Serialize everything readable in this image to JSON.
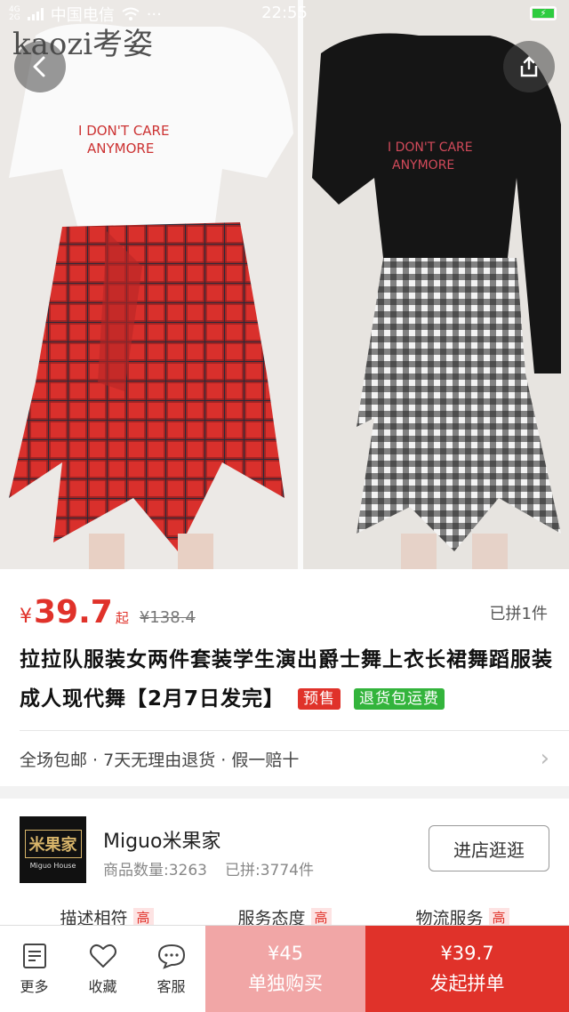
{
  "status_bar": {
    "net_top": "4G",
    "net_bottom": "2G",
    "carrier": "中国电信",
    "dots": "···",
    "time": "22:55",
    "battery_level": 1.0
  },
  "hero": {
    "watermark": "kaozi考姿"
  },
  "product": {
    "price_symbol": "¥",
    "price": "39.7",
    "price_suffix": "起",
    "original_price": "¥138.4",
    "sold": "已拼1件",
    "title": "拉拉队服装女两件套装学生演出爵士舞上衣长裙舞蹈服装成人现代舞【2月7日发完】",
    "tag_presale": "预售",
    "tag_return": "退货包运费",
    "services": "全场包邮 · 7天无理由退货 · 假一赔十"
  },
  "store": {
    "logo_cn": "米果家",
    "logo_en": "Miguo House",
    "name": "Miguo米果家",
    "goods_count": "商品数量:3263",
    "sold": "已拼:3774件",
    "visit_button": "进店逛逛",
    "ratings": [
      {
        "label": "描述相符",
        "badge": "高"
      },
      {
        "label": "服务态度",
        "badge": "高"
      },
      {
        "label": "物流服务",
        "badge": "高"
      }
    ]
  },
  "bottom_bar": {
    "more": "更多",
    "favorite": "收藏",
    "service": "客服",
    "buy_alone_price": "¥45",
    "buy_alone_label": "单独购买",
    "group_price": "¥39.7",
    "group_label": "发起拼单"
  },
  "colors": {
    "accent_red": "#e0322a",
    "light_red": "#f1a6a6",
    "green_tag": "#33b43c"
  }
}
